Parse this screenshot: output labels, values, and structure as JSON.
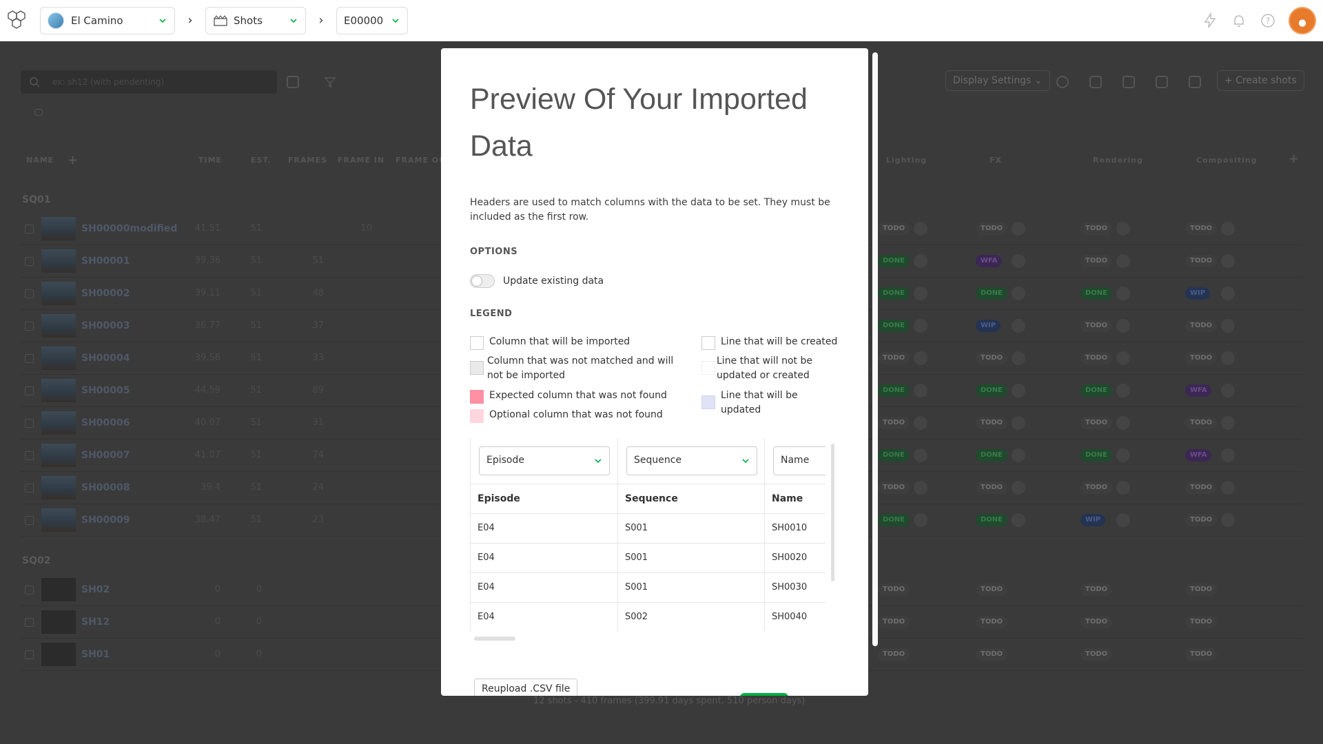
{
  "topbar": {
    "production": "El Camino",
    "section": "Shots",
    "episode": "E00000"
  },
  "background": {
    "search_placeholder": "ex: sh12 (with pendenting)",
    "display_settings": "Display Settings",
    "create_shots": "Create shots",
    "columns": {
      "name": "NAME",
      "time": "TIME",
      "est": "EST.",
      "frames": "FRAMES",
      "frame_in": "FRAME IN",
      "frame_out": "FRAME OU",
      "lighting": "Lighting",
      "fx": "FX",
      "rendering": "Rendering",
      "compositing": "Compositing"
    },
    "sequences": [
      "SQ01",
      "SQ02"
    ],
    "rows_sq01": [
      {
        "name": "SH00000modified",
        "time": "41.51",
        "est": "51",
        "frames": "",
        "frame_in": "10",
        "lighting": "TODO",
        "fx": "TODO",
        "rendering": "TODO",
        "compositing": "TODO"
      },
      {
        "name": "SH00001",
        "time": "39.36",
        "est": "51",
        "frames": "51",
        "frame_in": "",
        "lighting": "DONE",
        "fx": "WFA",
        "rendering": "TODO",
        "compositing": "TODO"
      },
      {
        "name": "SH00002",
        "time": "39.11",
        "est": "51",
        "frames": "48",
        "frame_in": "",
        "lighting": "DONE",
        "fx": "DONE",
        "rendering": "DONE",
        "compositing": "WIP"
      },
      {
        "name": "SH00003",
        "time": "36.77",
        "est": "51",
        "frames": "37",
        "frame_in": "",
        "lighting": "DONE",
        "fx": "WIP",
        "rendering": "TODO",
        "compositing": "TODO"
      },
      {
        "name": "SH00004",
        "time": "39.56",
        "est": "51",
        "frames": "33",
        "frame_in": "",
        "lighting": "TODO",
        "fx": "TODO",
        "rendering": "TODO",
        "compositing": "TODO"
      },
      {
        "name": "SH00005",
        "time": "44.59",
        "est": "51",
        "frames": "89",
        "frame_in": "",
        "lighting": "DONE",
        "fx": "DONE",
        "rendering": "DONE",
        "compositing": "WFA"
      },
      {
        "name": "SH00006",
        "time": "40.07",
        "est": "51",
        "frames": "31",
        "frame_in": "",
        "lighting": "TODO",
        "fx": "TODO",
        "rendering": "TODO",
        "compositing": "TODO"
      },
      {
        "name": "SH00007",
        "time": "41.07",
        "est": "51",
        "frames": "74",
        "frame_in": "",
        "lighting": "DONE",
        "fx": "DONE",
        "rendering": "DONE",
        "compositing": "WFA"
      },
      {
        "name": "SH00008",
        "time": "39.4",
        "est": "51",
        "frames": "24",
        "frame_in": "",
        "lighting": "TODO",
        "fx": "TODO",
        "rendering": "TODO",
        "compositing": "TODO"
      },
      {
        "name": "SH00009",
        "time": "38.47",
        "est": "51",
        "frames": "23",
        "frame_in": "",
        "lighting": "DONE",
        "fx": "DONE",
        "rendering": "WIP",
        "compositing": "TODO"
      }
    ],
    "rows_sq02": [
      {
        "name": "SH02",
        "time": "0",
        "est": "0",
        "lighting": "TODO",
        "fx": "TODO",
        "rendering": "TODO",
        "compositing": "TODO"
      },
      {
        "name": "SH12",
        "time": "0",
        "est": "0",
        "lighting": "TODO",
        "fx": "TODO",
        "rendering": "TODO",
        "compositing": "TODO"
      },
      {
        "name": "SH01",
        "time": "0",
        "est": "0",
        "lighting": "TODO",
        "fx": "TODO",
        "rendering": "TODO",
        "compositing": "TODO"
      }
    ],
    "footer": "12 shots - 410 frames (399.91 days spent, 510 person days)"
  },
  "modal": {
    "title": "Preview Of Your Imported Data",
    "description": "Headers are used to match columns with the data to be set. They must be included as the first row.",
    "options_heading": "OPTIONS",
    "toggle_label": "Update existing data",
    "legend_heading": "LEGEND",
    "legend": {
      "imported": "Column that will be imported",
      "not_matched": "Column that was not matched and will not be imported",
      "expected_not_found": "Expected column that was not found",
      "optional_not_found": "Optional column that was not found",
      "line_created": "Line that will be created",
      "line_not_updated": "Line that will not be updated or created",
      "line_updated": "Line that will be updated"
    },
    "table": {
      "selects": [
        "Episode",
        "Sequence",
        "Name"
      ],
      "headers": [
        "Episode",
        "Sequence",
        "Name"
      ],
      "rows": [
        [
          "E04",
          "S001",
          "SH0010"
        ],
        [
          "E04",
          "S001",
          "SH0020"
        ],
        [
          "E04",
          "S001",
          "SH0030"
        ],
        [
          "E04",
          "S002",
          "SH0040"
        ]
      ]
    },
    "reupload_label": "Reupload .CSV file"
  },
  "colors": {
    "accent_green": "#00b242",
    "expected_missing": "#ff8fa3",
    "optional_missing": "#ffd6de",
    "line_updated": "#e0e3f5"
  }
}
